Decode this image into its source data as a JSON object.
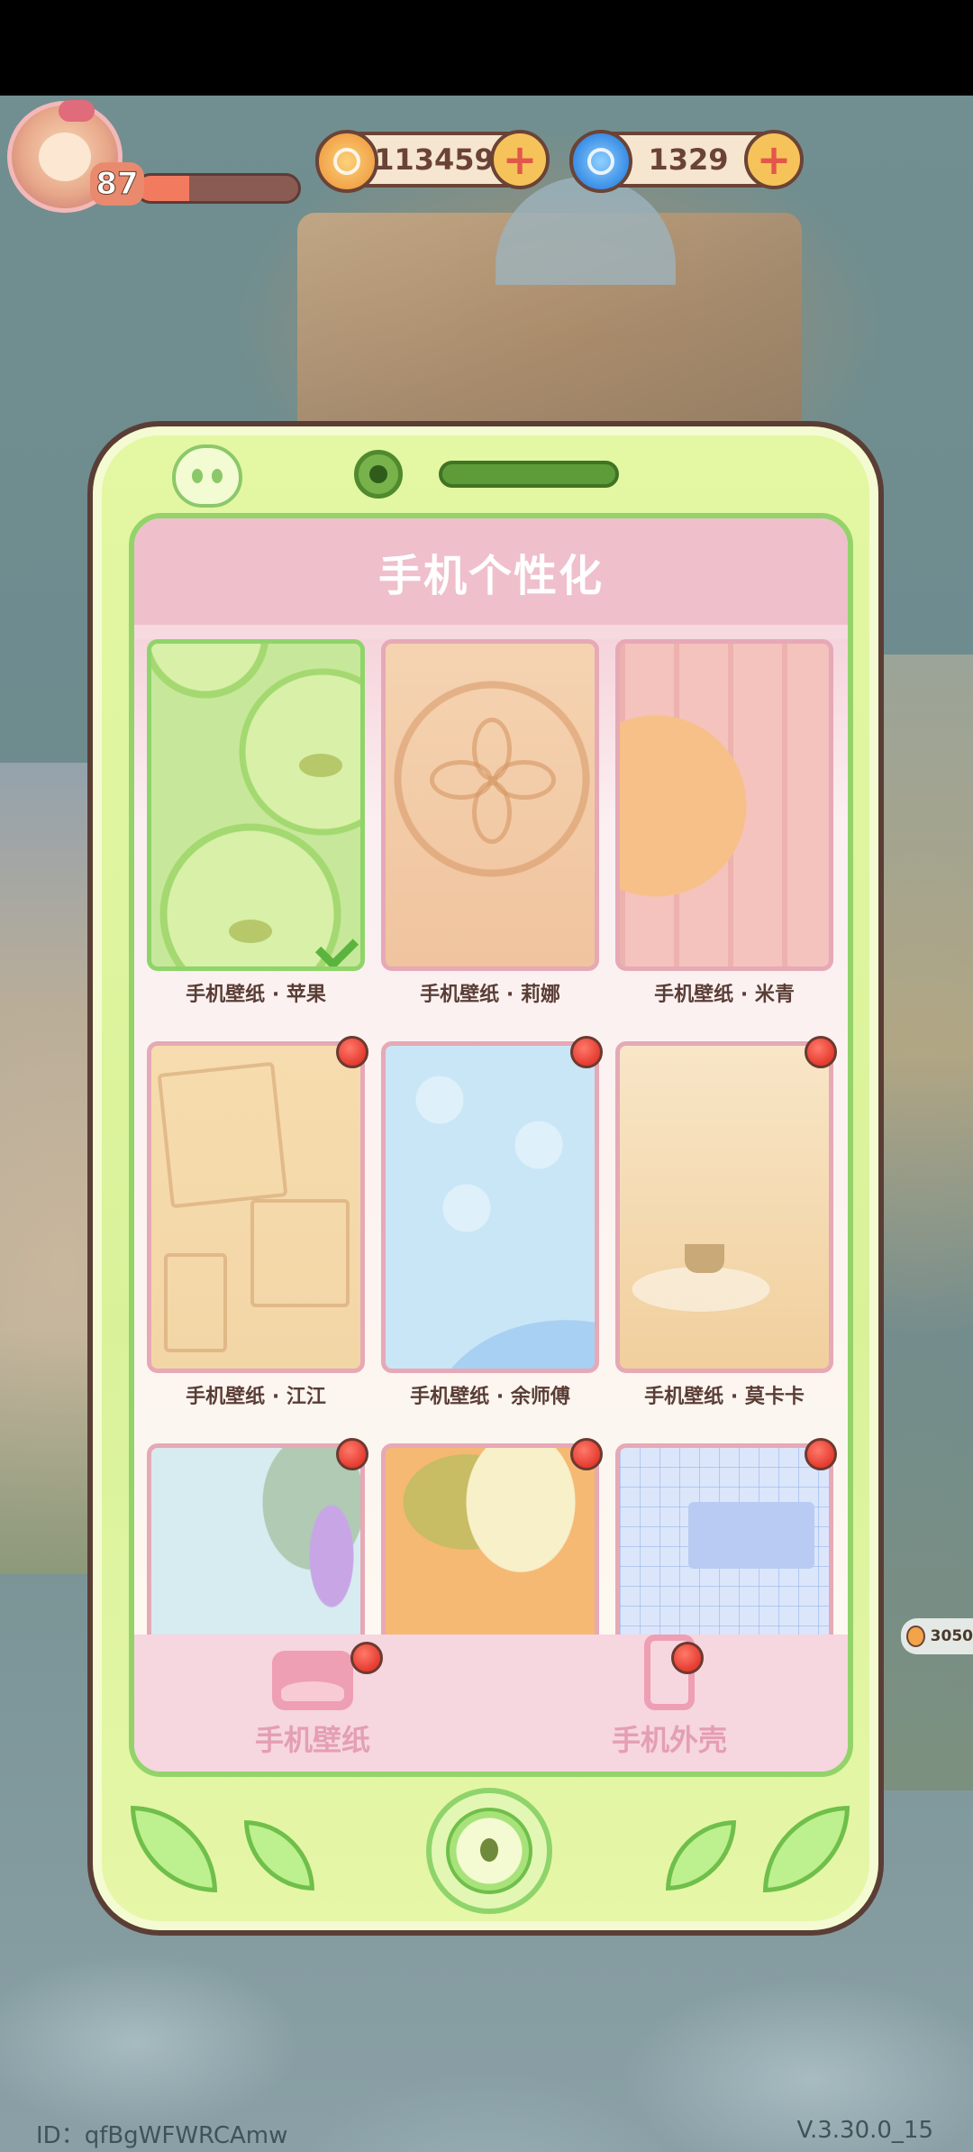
{
  "hud": {
    "level": "87",
    "xp_progress": 0.32,
    "gold_amount": "113459",
    "gem_amount": "1329",
    "add_label": "+"
  },
  "side_reward": {
    "amount": "3050"
  },
  "modal": {
    "title": "手机个性化",
    "wallpapers": [
      {
        "label": "手机壁纸 · 苹果",
        "selected": true,
        "is_new": false,
        "thumb": "apple"
      },
      {
        "label": "手机壁纸 · 莉娜",
        "selected": false,
        "is_new": false,
        "thumb": "lina"
      },
      {
        "label": "手机壁纸 · 米青",
        "selected": false,
        "is_new": false,
        "thumb": "miqing"
      },
      {
        "label": "手机壁纸 · 江江",
        "selected": false,
        "is_new": true,
        "thumb": "jiangjiang"
      },
      {
        "label": "手机壁纸 · 余师傅",
        "selected": false,
        "is_new": true,
        "thumb": "yushifu"
      },
      {
        "label": "手机壁纸 · 莫卡卡",
        "selected": false,
        "is_new": true,
        "thumb": "mokaka"
      },
      {
        "label": "",
        "selected": false,
        "is_new": true,
        "thumb": "wisteria"
      },
      {
        "label": "",
        "selected": false,
        "is_new": true,
        "thumb": "orange"
      },
      {
        "label": "",
        "selected": false,
        "is_new": true,
        "thumb": "grid"
      }
    ],
    "tabs": [
      {
        "label": "手机壁纸",
        "icon": "wallpaper-icon",
        "active": true
      },
      {
        "label": "手机外壳",
        "icon": "phone-case-icon",
        "active": false
      }
    ]
  },
  "footer": {
    "user_id": "ID：qfBgWFWRCAmw",
    "version": "V.3.30.0_15"
  },
  "colors": {
    "phone_body": "#e4f7a3",
    "header_pink": "#efbfcc",
    "tab_pink": "#e49fb2",
    "new_badge": "#e53b30",
    "selected_border": "#8fd46a"
  }
}
